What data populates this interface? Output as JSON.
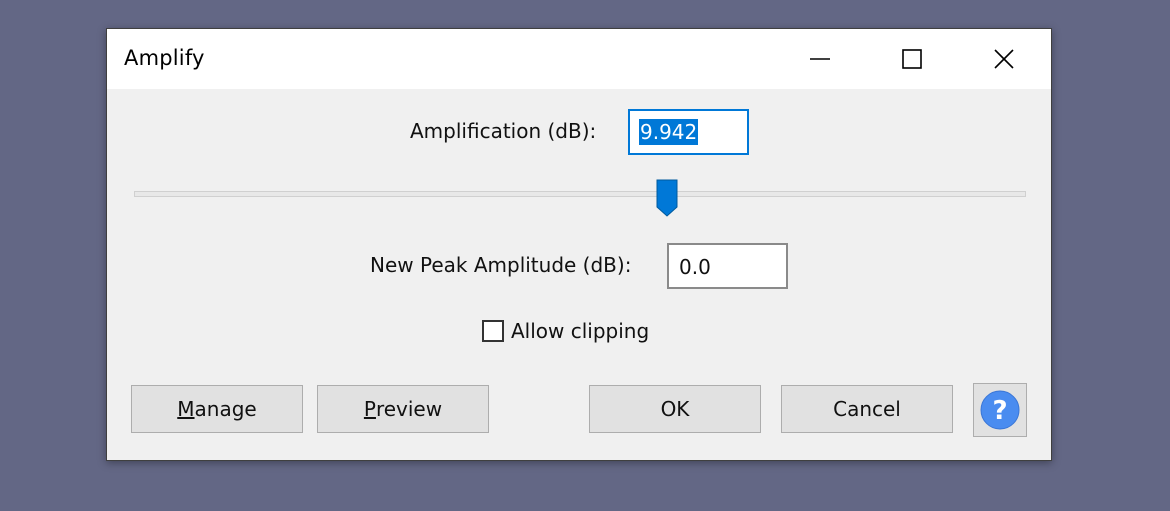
{
  "window": {
    "title": "Amplify",
    "controls": {
      "minimize": "minimize-icon",
      "maximize": "maximize-icon",
      "close": "close-icon"
    }
  },
  "amplification": {
    "label": "Amplification (dB):",
    "value": "9.942",
    "selected": true
  },
  "slider": {
    "position_fraction": 0.597,
    "accent": "#0078d7"
  },
  "peak": {
    "label": "New Peak Amplitude (dB):",
    "value": "0.0"
  },
  "clipping": {
    "label": "Allow clipping",
    "checked": false
  },
  "buttons": {
    "manage": {
      "mnemonic": "M",
      "rest": "anage"
    },
    "preview": {
      "mnemonic": "P",
      "rest": "review"
    },
    "ok": "OK",
    "cancel": "Cancel",
    "help": {
      "icon": "help-icon",
      "glyph": "?",
      "color": "#4a8cf0"
    }
  }
}
